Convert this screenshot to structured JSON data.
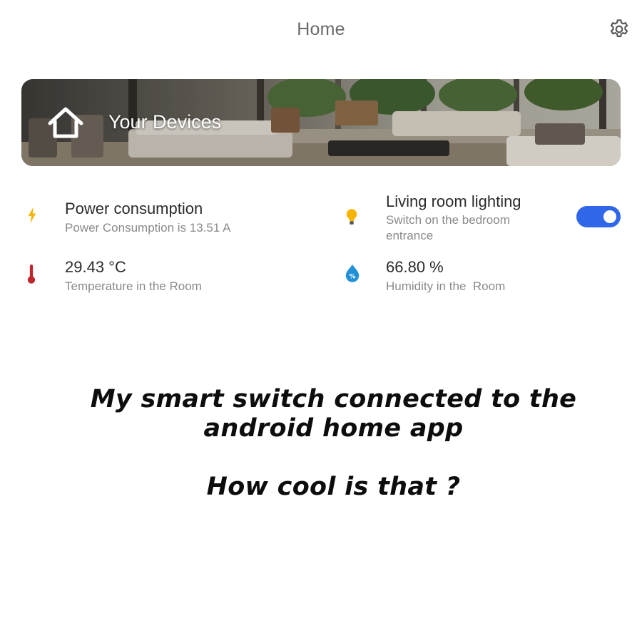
{
  "header": {
    "title": "Home",
    "settings_icon": "gear-icon"
  },
  "banner": {
    "icon": "home-icon",
    "label": "Your Devices"
  },
  "devices": {
    "power": {
      "icon": "lightning-icon",
      "title": "Power consumption",
      "subtitle": "Power Consumption is 13.51 A",
      "icon_color": "#f4b400"
    },
    "lighting": {
      "icon": "lightbulb-icon",
      "title": "Living room lighting",
      "subtitle": "Switch on the bedroom entrance",
      "switch_on": true,
      "icon_color": "#f4b400",
      "switch_color": "#2f67e8"
    },
    "temperature": {
      "icon": "thermometer-icon",
      "value": "29.43 °C",
      "subtitle": "Temperature in the Room",
      "icon_color": "#c0262d"
    },
    "humidity": {
      "icon": "humidity-drop-icon",
      "value": "66.80 %",
      "subtitle": "Humidity in the  Room",
      "icon_color": "#1f8fd6"
    }
  },
  "caption": {
    "line1": "My smart switch connected to the",
    "line2": "android home app",
    "line3": "How cool is that ?"
  }
}
